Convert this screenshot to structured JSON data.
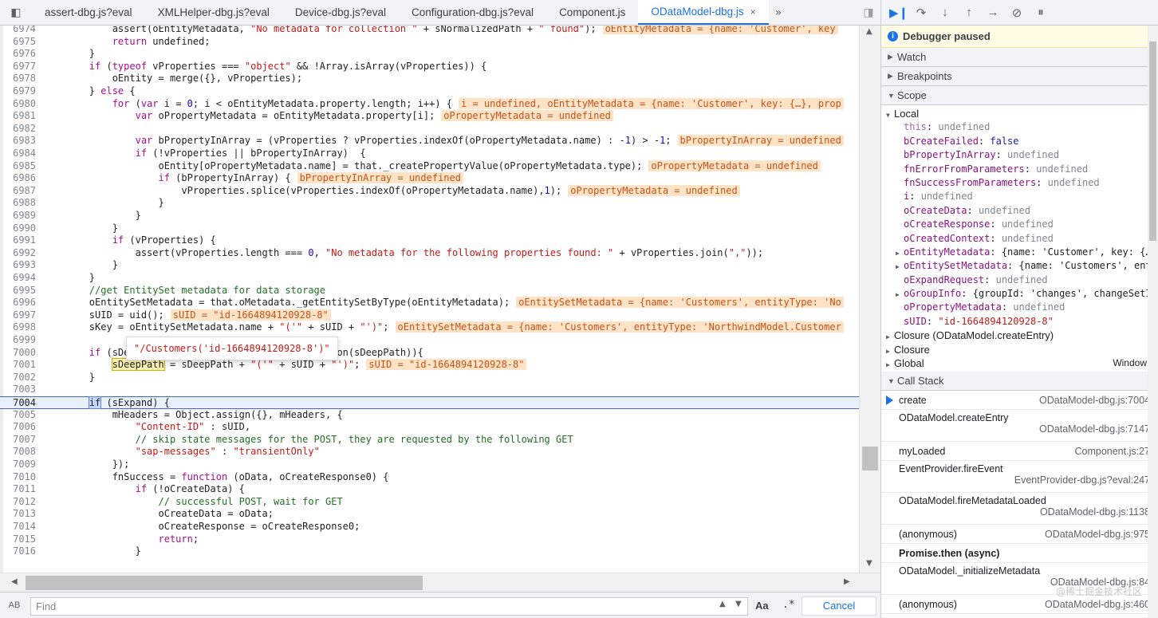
{
  "tabs": [
    {
      "label": "assert-dbg.js?eval",
      "active": false
    },
    {
      "label": "XMLHelper-dbg.js?eval",
      "active": false
    },
    {
      "label": "Device-dbg.js?eval",
      "active": false
    },
    {
      "label": "Configuration-dbg.js?eval",
      "active": false
    },
    {
      "label": "Component.js",
      "active": false
    },
    {
      "label": "ODataModel-dbg.js",
      "active": true
    }
  ],
  "tab_close_glyph": "×",
  "tab_more_glyph": "»",
  "code": [
    {
      "n": "6974",
      "parts": [
        [
          "",
          "            assert(oEntityMetadata, "
        ],
        [
          "str",
          "\"No metadata for collection \""
        ],
        [
          "",
          " + sNormalizedPath + "
        ],
        [
          "str",
          "\" found\""
        ],
        [
          "",
          ");"
        ]
      ],
      "hint": "oEntityMetadata = {name: 'Customer', key"
    },
    {
      "n": "6975",
      "parts": [
        [
          "",
          "            "
        ],
        [
          "kw",
          "return"
        ],
        [
          "",
          " undefined;"
        ]
      ]
    },
    {
      "n": "6976",
      "parts": [
        [
          "",
          "        }"
        ]
      ]
    },
    {
      "n": "6977",
      "parts": [
        [
          "",
          "        "
        ],
        [
          "kw",
          "if"
        ],
        [
          "",
          " ("
        ],
        [
          "kw",
          "typeof"
        ],
        [
          "",
          " vProperties === "
        ],
        [
          "str",
          "\"object\""
        ],
        [
          "",
          " && !Array.isArray(vProperties)) {"
        ]
      ]
    },
    {
      "n": "6978",
      "parts": [
        [
          "",
          "            oEntity = merge({}, vProperties);"
        ]
      ]
    },
    {
      "n": "6979",
      "parts": [
        [
          "",
          "        } "
        ],
        [
          "kw",
          "else"
        ],
        [
          "",
          " {"
        ]
      ]
    },
    {
      "n": "6980",
      "parts": [
        [
          "",
          "            "
        ],
        [
          "kw",
          "for"
        ],
        [
          "",
          " ("
        ],
        [
          "kw",
          "var"
        ],
        [
          "",
          " i = "
        ],
        [
          "num",
          "0"
        ],
        [
          "",
          "; i < oEntityMetadata.property.length; i++) {"
        ]
      ],
      "hint": "i = undefined, oEntityMetadata = {name: 'Customer', key: {…}, prop"
    },
    {
      "n": "6981",
      "parts": [
        [
          "",
          "                "
        ],
        [
          "kw",
          "var"
        ],
        [
          "",
          " oPropertyMetadata = oEntityMetadata.property[i];"
        ]
      ],
      "hint": "oPropertyMetadata = undefined"
    },
    {
      "n": "6982",
      "parts": [
        [
          "",
          ""
        ]
      ]
    },
    {
      "n": "6983",
      "parts": [
        [
          "",
          "                "
        ],
        [
          "kw",
          "var"
        ],
        [
          "",
          " bPropertyInArray = (vProperties ? vProperties.indexOf(oPropertyMetadata.name) : -"
        ],
        [
          "num",
          "1"
        ],
        [
          "",
          ") > -"
        ],
        [
          "num",
          "1"
        ],
        [
          "",
          ";"
        ]
      ],
      "hint": "bPropertyInArray = undefined"
    },
    {
      "n": "6984",
      "parts": [
        [
          "",
          "                "
        ],
        [
          "kw",
          "if"
        ],
        [
          "",
          " (!vProperties || bPropertyInArray)  {"
        ]
      ]
    },
    {
      "n": "6985",
      "parts": [
        [
          "",
          "                    oEntity[oPropertyMetadata.name] = that._createPropertyValue(oPropertyMetadata.type);"
        ]
      ],
      "hint": "oPropertyMetadata = undefined"
    },
    {
      "n": "6986",
      "parts": [
        [
          "",
          "                    "
        ],
        [
          "kw",
          "if"
        ],
        [
          "",
          " (bPropertyInArray) {"
        ]
      ],
      "hint": "bPropertyInArray = undefined"
    },
    {
      "n": "6987",
      "parts": [
        [
          "",
          "                        vProperties.splice(vProperties.indexOf(oPropertyMetadata.name),"
        ],
        [
          "num",
          "1"
        ],
        [
          "",
          ");"
        ]
      ],
      "hint": "oPropertyMetadata = undefined"
    },
    {
      "n": "6988",
      "parts": [
        [
          "",
          "                    }"
        ]
      ]
    },
    {
      "n": "6989",
      "parts": [
        [
          "",
          "                }"
        ]
      ]
    },
    {
      "n": "6990",
      "parts": [
        [
          "",
          "            }"
        ]
      ]
    },
    {
      "n": "6991",
      "parts": [
        [
          "",
          "            "
        ],
        [
          "kw",
          "if"
        ],
        [
          "",
          " (vProperties) {"
        ]
      ]
    },
    {
      "n": "6992",
      "parts": [
        [
          "",
          "                assert(vProperties.length === "
        ],
        [
          "num",
          "0"
        ],
        [
          "",
          ", "
        ],
        [
          "str",
          "\"No metadata for the following properties found: \""
        ],
        [
          "",
          " + vProperties.join("
        ],
        [
          "str",
          "\",\""
        ],
        [
          "",
          "));"
        ]
      ]
    },
    {
      "n": "6993",
      "parts": [
        [
          "",
          "            }"
        ]
      ]
    },
    {
      "n": "6994",
      "parts": [
        [
          "",
          "        }"
        ]
      ]
    },
    {
      "n": "6995",
      "parts": [
        [
          "cm",
          "        //get EntitySet metadata for data storage"
        ]
      ]
    },
    {
      "n": "6996",
      "parts": [
        [
          "",
          "        oEntitySetMetadata = that.oMetadata._getEntitySetByType(oEntityMetadata);"
        ]
      ],
      "hint": "oEntitySetMetadata = {name: 'Customers', entityType: 'No"
    },
    {
      "n": "6997",
      "parts": [
        [
          "",
          "        sUID = uid();"
        ]
      ],
      "hint": "sUID = \"id-1664894120928-8\""
    },
    {
      "n": "6998",
      "parts": [
        [
          "",
          "        sKey = oEntitySetMetadata.name + "
        ],
        [
          "str",
          "\"('\""
        ],
        [
          "",
          " + sUID + "
        ],
        [
          "str",
          "\"')\""
        ],
        [
          "",
          ";"
        ]
      ],
      "hint": "oEntitySetMetadata = {name: 'Customers', entityType: 'NorthwindModel.Customer"
    },
    {
      "n": "6999",
      "parts": [
        [
          "",
          ""
        ]
      ]
    },
    {
      "n": "7000",
      "parts": [
        [
          "",
          "        "
        ],
        [
          "kw",
          "if"
        ],
        [
          "",
          " (sDeepPath && that.oMetadata._isCollection(sDeepPath)){"
        ]
      ]
    },
    {
      "n": "7001",
      "parts": [
        [
          "",
          "            "
        ],
        [
          "hov",
          "sDeepPath"
        ],
        [
          "",
          " = sDeepPath + "
        ],
        [
          "str",
          "\"('\""
        ],
        [
          "",
          " + sUID + "
        ],
        [
          "str",
          "\"')\""
        ],
        [
          "",
          ";"
        ]
      ],
      "hint": "sUID = \"id-1664894120928-8\""
    },
    {
      "n": "7002",
      "parts": [
        [
          "",
          "        }"
        ]
      ]
    },
    {
      "n": "7003",
      "parts": [
        [
          "",
          ""
        ]
      ]
    },
    {
      "n": "7004",
      "parts": [
        [
          "",
          "        "
        ],
        [
          "exec",
          "if"
        ],
        [
          "",
          " (sExpand) {"
        ]
      ],
      "current": true
    },
    {
      "n": "7005",
      "parts": [
        [
          "",
          "            mHeaders = Object.assign({}, mHeaders, {"
        ]
      ]
    },
    {
      "n": "7006",
      "parts": [
        [
          "",
          "                "
        ],
        [
          "str",
          "\"Content-ID\""
        ],
        [
          "",
          " : sUID,"
        ]
      ]
    },
    {
      "n": "7007",
      "parts": [
        [
          "cm",
          "                // skip state messages for the POST, they are requested by the following GET"
        ]
      ]
    },
    {
      "n": "7008",
      "parts": [
        [
          "",
          "                "
        ],
        [
          "str",
          "\"sap-messages\""
        ],
        [
          "",
          " : "
        ],
        [
          "str",
          "\"transientOnly\""
        ]
      ]
    },
    {
      "n": "7009",
      "parts": [
        [
          "",
          "            });"
        ]
      ]
    },
    {
      "n": "7010",
      "parts": [
        [
          "",
          "            fnSuccess = "
        ],
        [
          "kw",
          "function"
        ],
        [
          "",
          " (oData, oCreateResponse0) {"
        ]
      ]
    },
    {
      "n": "7011",
      "parts": [
        [
          "",
          "                "
        ],
        [
          "kw",
          "if"
        ],
        [
          "",
          " (!oCreateData) {"
        ]
      ]
    },
    {
      "n": "7012",
      "parts": [
        [
          "cm",
          "                    // successful POST, wait for GET"
        ]
      ]
    },
    {
      "n": "7013",
      "parts": [
        [
          "",
          "                    oCreateData = oData;"
        ]
      ]
    },
    {
      "n": "7014",
      "parts": [
        [
          "",
          "                    oCreateResponse = oCreateResponse0;"
        ]
      ]
    },
    {
      "n": "7015",
      "parts": [
        [
          "",
          "                    "
        ],
        [
          "kw",
          "return"
        ],
        [
          "",
          ";"
        ]
      ]
    },
    {
      "n": "7016",
      "parts": [
        [
          "",
          "                }"
        ]
      ]
    }
  ],
  "tooltip": "\"/Customers('id-1664894120928-8')\"",
  "find": {
    "placeholder": "Find",
    "case_label": "Aa",
    "regex_label": ".*",
    "cancel_label": "Cancel",
    "replace_toggle": "AB"
  },
  "debugger": {
    "paused_label": "Debugger paused",
    "sections": {
      "watch": "Watch",
      "breakpoints": "Breakpoints",
      "scope": "Scope",
      "callstack": "Call Stack"
    },
    "scope_local_label": "Local",
    "scope": [
      {
        "k": "this",
        "v": "undefined",
        "t": "undef",
        "dim": true
      },
      {
        "k": "bCreateFailed",
        "v": "false",
        "t": "bool"
      },
      {
        "k": "bPropertyInArray",
        "v": "undefined",
        "t": "undef"
      },
      {
        "k": "fnErrorFromParameters",
        "v": "undefined",
        "t": "undef"
      },
      {
        "k": "fnSuccessFromParameters",
        "v": "undefined",
        "t": "undef"
      },
      {
        "k": "i",
        "v": "undefined",
        "t": "undef"
      },
      {
        "k": "oCreateData",
        "v": "undefined",
        "t": "undef"
      },
      {
        "k": "oCreateResponse",
        "v": "undefined",
        "t": "undef"
      },
      {
        "k": "oCreatedContext",
        "v": "undefined",
        "t": "undef"
      },
      {
        "k": "oEntityMetadata",
        "v": "{name: 'Customer', key: {…",
        "t": "obj",
        "expand": true
      },
      {
        "k": "oEntitySetMetadata",
        "v": "{name: 'Customers', ent",
        "t": "obj",
        "expand": true
      },
      {
        "k": "oExpandRequest",
        "v": "undefined",
        "t": "undef"
      },
      {
        "k": "oGroupInfo",
        "v": "{groupId: 'changes', changeSetI",
        "t": "obj",
        "expand": true
      },
      {
        "k": "oPropertyMetadata",
        "v": "undefined",
        "t": "undef"
      },
      {
        "k": "sUID",
        "v": "\"id-1664894120928-8\"",
        "t": "str"
      }
    ],
    "scope_groups": [
      {
        "label": "Closure (ODataModel.createEntry)",
        "right": ""
      },
      {
        "label": "Closure",
        "right": ""
      },
      {
        "label": "Global",
        "right": "Window"
      }
    ],
    "callstack": [
      {
        "fn": "create",
        "loc": "ODataModel-dbg.js:7004",
        "layout": "single",
        "selected": true
      },
      {
        "fn": "ODataModel.createEntry",
        "loc": "ODataModel-dbg.js:7147",
        "layout": "double"
      },
      {
        "fn": "myLoaded",
        "loc": "Component.js:27",
        "layout": "single"
      },
      {
        "fn": "EventProvider.fireEvent",
        "loc": "EventProvider-dbg.js?eval:247",
        "layout": "double"
      },
      {
        "fn": "ODataModel.fireMetadataLoaded",
        "loc": "ODataModel-dbg.js:1138",
        "layout": "double"
      },
      {
        "fn": "(anonymous)",
        "loc": "ODataModel-dbg.js:975",
        "layout": "single"
      },
      {
        "fn": "Promise.then (async)",
        "loc": "",
        "layout": "async"
      },
      {
        "fn": "ODataModel._initializeMetadata",
        "loc": "ODataModel-dbg.js:84",
        "layout": "double"
      },
      {
        "fn": "(anonymous)",
        "loc": "ODataModel-dbg.js:460",
        "layout": "single"
      }
    ],
    "watermark": "@稀土掘金技术社区"
  }
}
